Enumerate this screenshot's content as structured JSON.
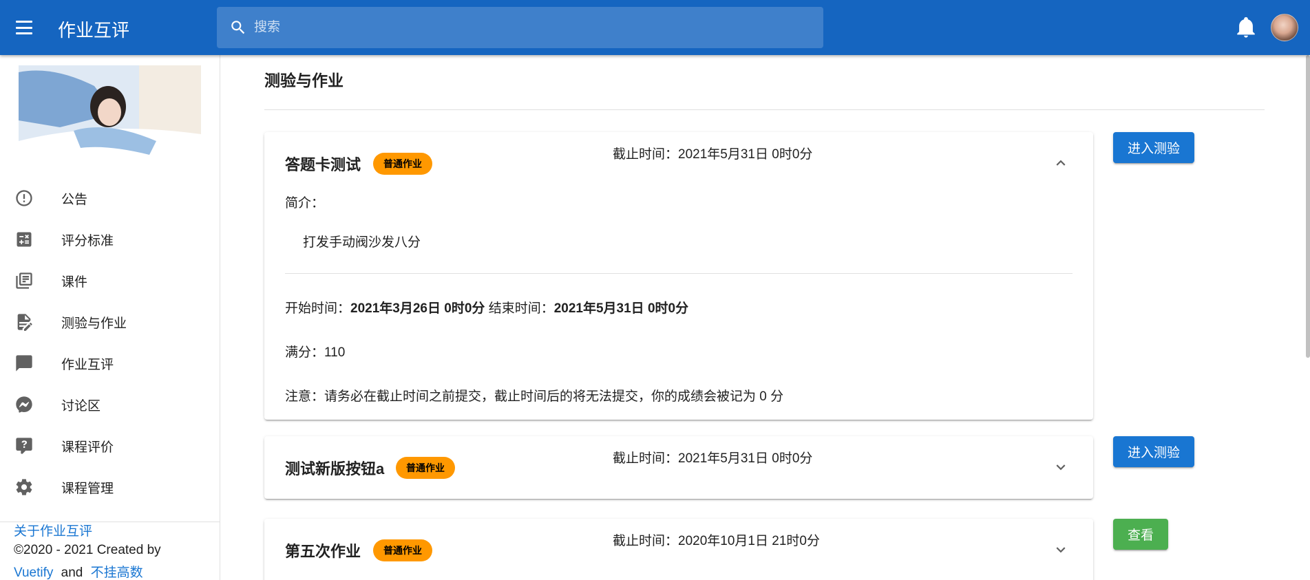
{
  "app": {
    "title": "作业互评"
  },
  "search": {
    "placeholder": "搜索"
  },
  "header_icons": {
    "menu": "menu-icon",
    "search": "magnify-icon",
    "notifications": "bell-icon",
    "avatar": "user-avatar"
  },
  "sidebar": {
    "items": [
      {
        "label": "公告",
        "icon": "alert-circle-outline-icon"
      },
      {
        "label": "评分标准",
        "icon": "calculator-icon"
      },
      {
        "label": "课件",
        "icon": "library-books-icon"
      },
      {
        "label": "测验与作业",
        "icon": "file-edit-icon"
      },
      {
        "label": "作业互评",
        "icon": "message-icon"
      },
      {
        "label": "讨论区",
        "icon": "messenger-icon"
      },
      {
        "label": "课程评价",
        "icon": "comment-question-icon"
      },
      {
        "label": "课程管理",
        "icon": "cog-icon"
      }
    ],
    "footer": {
      "about": "关于作业互评",
      "copyright": "©2020 - 2021 Created by",
      "link1": "Vuetify",
      "and": "and",
      "link2": "不挂高数"
    }
  },
  "main": {
    "title": "测验与作业",
    "assignments": [
      {
        "title": "答题卡测试",
        "badge": "普通作业",
        "deadline": "截止时间：2021年5月31日 0时0分",
        "expanded": true,
        "intro_label": "简介：",
        "intro_text": "打发手动阀沙发八分",
        "start_label": "开始时间：",
        "start_value": "2021年3月26日 0时0分",
        "end_label": "结束时间：",
        "end_value": "2021年5月31日 0时0分",
        "full_score": "满分：110",
        "note": "注意：请务必在截止时间之前提交，截止时间后的将无法提交，你的成绩会被记为 0 分",
        "action": "进入测验",
        "action_color": "#1976d2"
      },
      {
        "title": "测试新版按钮a",
        "badge": "普通作业",
        "deadline": "截止时间：2021年5月31日 0时0分",
        "expanded": false,
        "action": "进入测验",
        "action_color": "#1976d2"
      },
      {
        "title": "第五次作业",
        "badge": "普通作业",
        "deadline": "截止时间：2020年10月1日 21时0分",
        "expanded": false,
        "action": "查看",
        "action_color": "#4caf50"
      }
    ]
  },
  "colors": {
    "primary": "#1565c0",
    "accent_blue": "#1976d2",
    "badge_orange": "#ff9800",
    "success_green": "#4caf50"
  }
}
